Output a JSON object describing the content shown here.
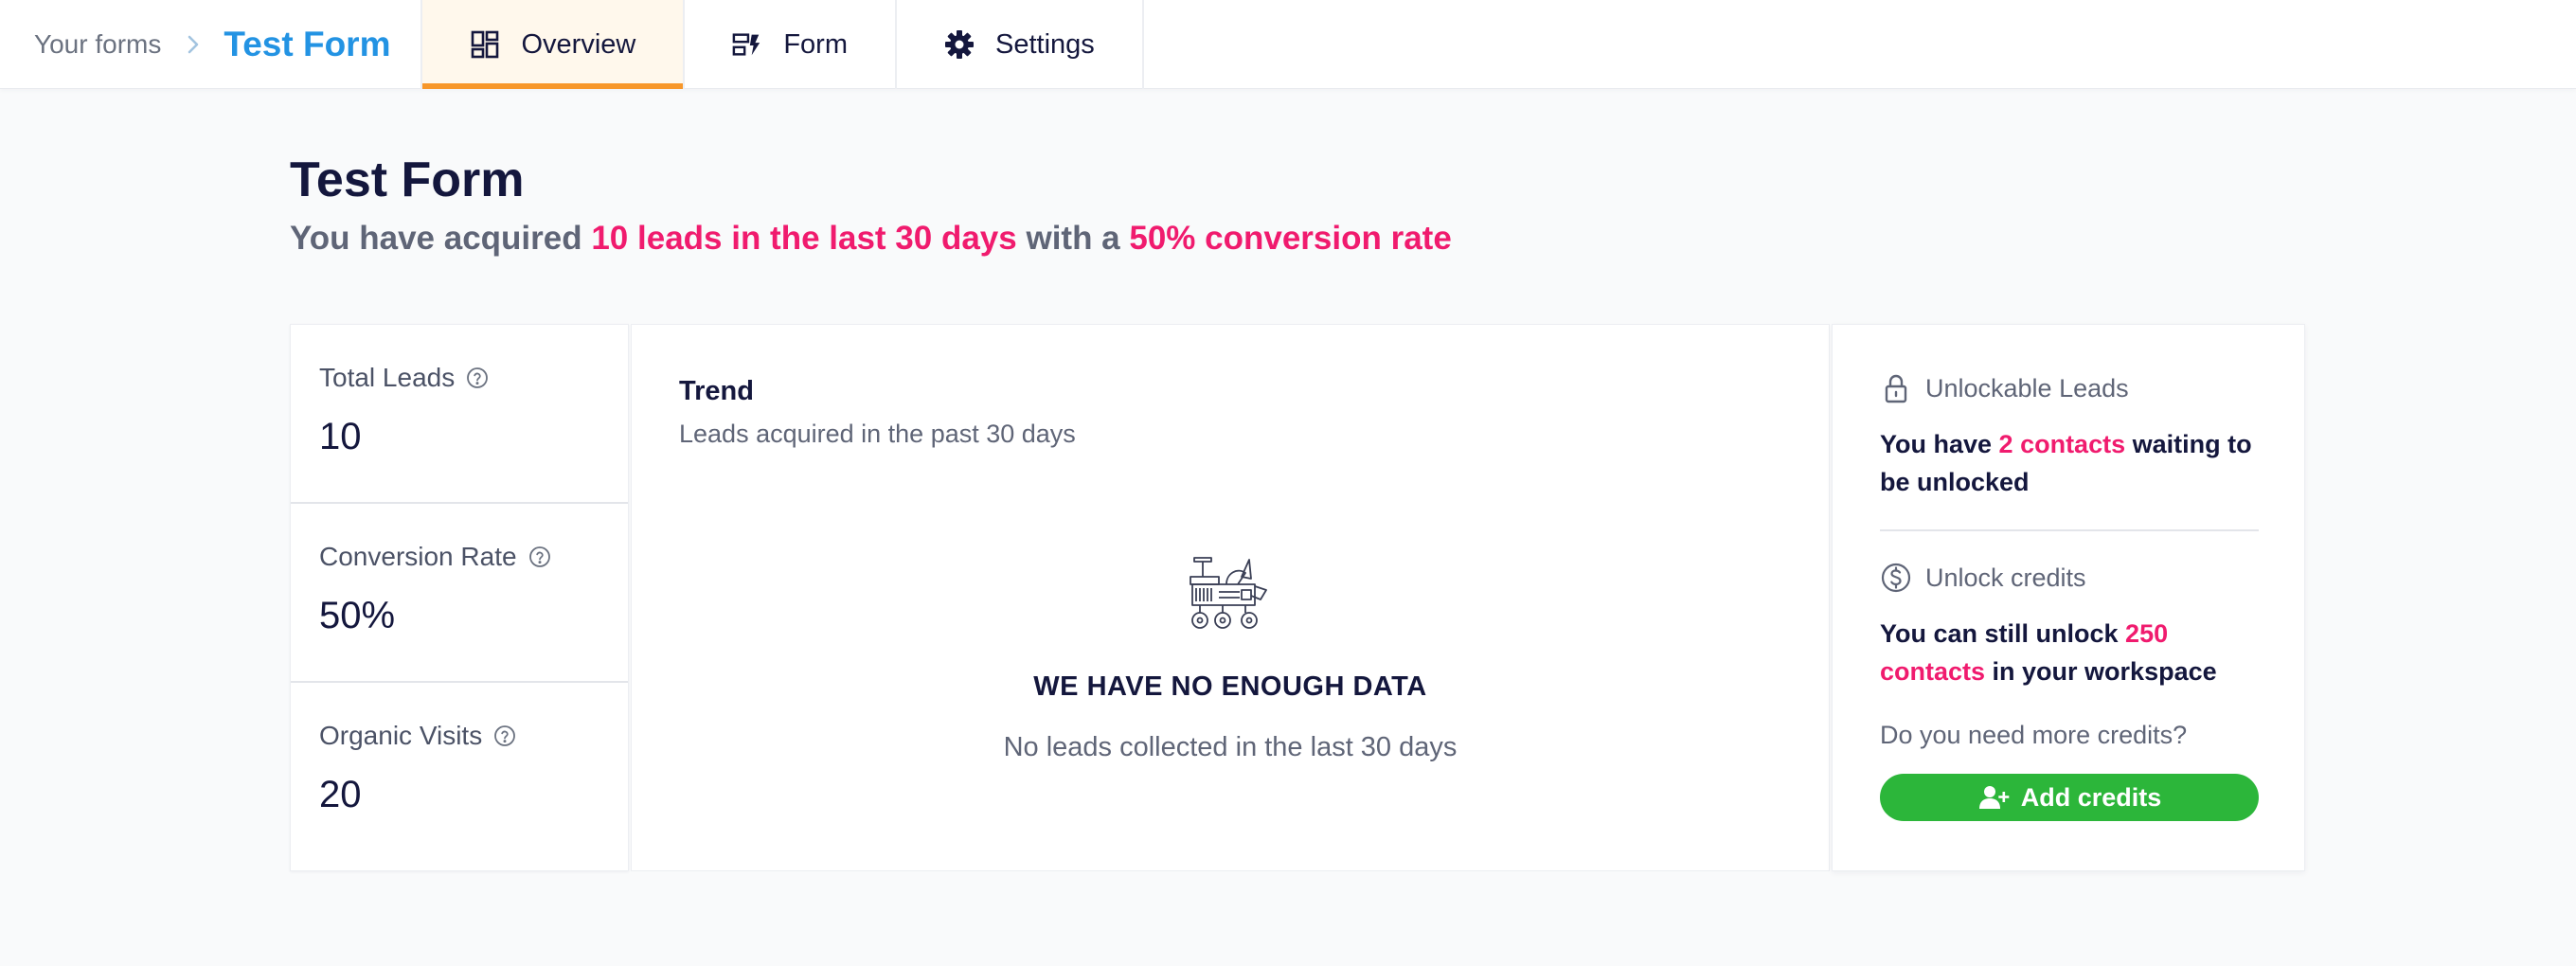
{
  "breadcrumb": {
    "root": "Your forms",
    "current": "Test Form"
  },
  "tabs": [
    {
      "label": "Overview",
      "icon": "dashboard-icon",
      "active": true
    },
    {
      "label": "Form",
      "icon": "form-fields-icon",
      "active": false
    },
    {
      "label": "Settings",
      "icon": "gear-icon",
      "active": false
    }
  ],
  "header": {
    "title": "Test Form",
    "subtitle_prefix": "You have acquired ",
    "subtitle_leads": "10 leads in the last 30 days",
    "subtitle_mid": " with a ",
    "subtitle_rate": "50% conversion rate"
  },
  "stats": [
    {
      "label": "Total Leads",
      "value": "10"
    },
    {
      "label": "Conversion Rate",
      "value": "50%"
    },
    {
      "label": "Organic Visits",
      "value": "20"
    }
  ],
  "trend": {
    "title": "Trend",
    "subtitle": "Leads acquired in the past 30 days",
    "empty_title": "WE HAVE NO ENOUGH DATA",
    "empty_subtitle": "No leads collected in the last 30 days",
    "empty_icon": "rover-icon"
  },
  "unlockable": {
    "title": "Unlockable Leads",
    "text_prefix": "You have ",
    "text_highlight": "2 contacts",
    "text_suffix": " waiting to be unlocked",
    "credits_title": "Unlock credits",
    "credits_prefix": "You can still unlock ",
    "credits_highlight": "250 contacts",
    "credits_suffix": " in your workspace",
    "need_more": "Do you need more credits?",
    "button_label": "Add credits"
  },
  "colors": {
    "accent_blue": "#2393e3",
    "highlight_pink": "#f01b6e",
    "active_tab_underline": "#f7972a",
    "button_green": "#2cb63a"
  }
}
